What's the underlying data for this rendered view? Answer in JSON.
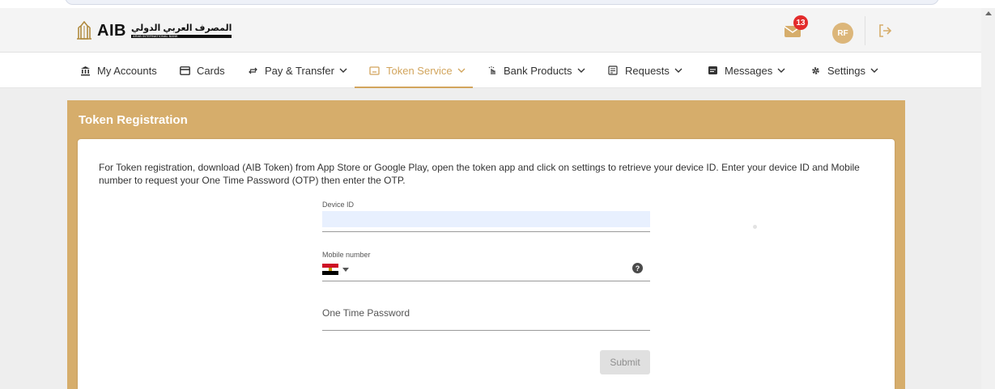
{
  "header": {
    "logo_text": "AIB",
    "logo_arabic": "المصرف العربي الدولي",
    "logo_subtext": "ARAB INTERNATIONAL BANK",
    "mail_badge_count": "13",
    "avatar_initials": "RF"
  },
  "nav": {
    "items": [
      {
        "label": "My Accounts",
        "icon": "bank-icon"
      },
      {
        "label": "Cards",
        "icon": "card-icon"
      },
      {
        "label": "Pay & Transfer",
        "icon": "transfer-icon"
      },
      {
        "label": "Token Service",
        "icon": "token-icon"
      },
      {
        "label": "Bank Products",
        "icon": "touch-icon"
      },
      {
        "label": "Requests",
        "icon": "requests-icon"
      },
      {
        "label": "Messages",
        "icon": "messages-icon"
      },
      {
        "label": "Settings",
        "icon": "gear-icon"
      }
    ],
    "active": "Token Service"
  },
  "page": {
    "title": "Token Registration",
    "intro": "For Token registration, download (AIB Token) from App Store or Google Play, open the token app and click on settings to retrieve your device ID. Enter your device ID and Mobile number to request your One Time Password (OTP) then enter the OTP."
  },
  "form": {
    "device_id_label": "Device ID",
    "device_id_value": "",
    "mobile_label": "Mobile number",
    "mobile_value": "",
    "country_flag": "egypt-flag",
    "otp_placeholder": "One Time Password",
    "submit_label": "Submit"
  },
  "colors": {
    "accent": "#d6ad6b",
    "active_nav": "#d2a55d",
    "badge": "#e32b2b"
  }
}
